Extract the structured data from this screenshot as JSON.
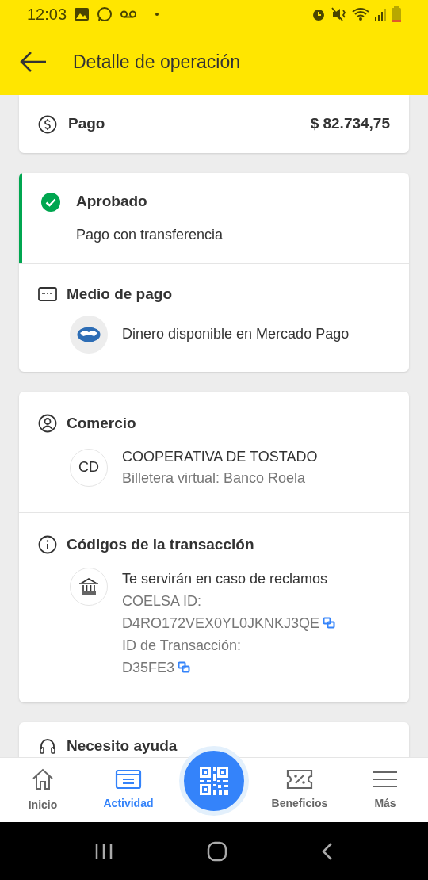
{
  "status_bar": {
    "time": "12:03"
  },
  "header": {
    "title": "Detalle de operación"
  },
  "payment": {
    "label": "Pago",
    "amount": "$ 82.734,75"
  },
  "status": {
    "title": "Aprobado",
    "approved": true,
    "subtitle": "Pago con transferencia"
  },
  "payment_method": {
    "title": "Medio de pago",
    "description": "Dinero disponible en Mercado Pago"
  },
  "merchant": {
    "title": "Comercio",
    "initials": "CD",
    "name": "COOPERATIVA DE TOSTADO",
    "subtitle": "Billetera virtual: Banco Roela"
  },
  "codes": {
    "title": "Códigos de la transacción",
    "note": "Te servirán en caso de reclamos",
    "items": [
      {
        "label": "COELSA ID:",
        "value": "D4RO172VEX0YL0JKNKJ3QE"
      },
      {
        "label": "ID de Transacción:",
        "value": "D35FE3"
      }
    ]
  },
  "help": {
    "title": "Necesito ayuda"
  },
  "bottom_nav": [
    {
      "kind": "home",
      "label": "Inicio",
      "selected": false
    },
    {
      "kind": "activity",
      "label": "Actividad",
      "selected": true
    },
    {
      "kind": "qr"
    },
    {
      "kind": "benefits",
      "label": "Beneficios",
      "selected": false
    },
    {
      "kind": "menu",
      "label": "Más",
      "selected": false
    }
  ]
}
